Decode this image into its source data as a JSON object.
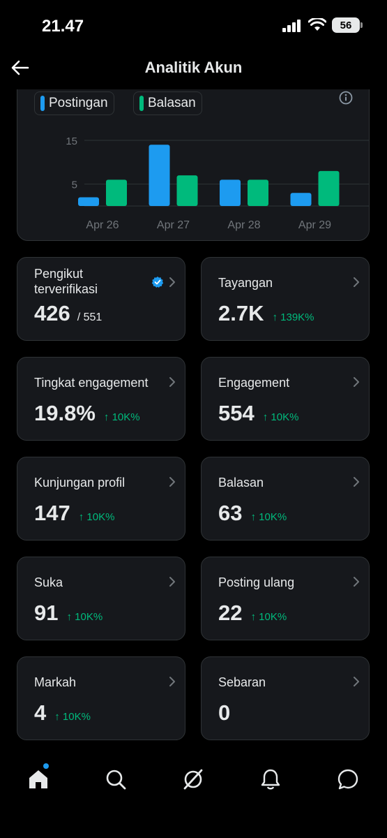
{
  "status_bar": {
    "time": "21.47",
    "battery": "56"
  },
  "header": {
    "title": "Analitik Akun"
  },
  "chart_data": {
    "type": "bar",
    "categories": [
      "Apr 26",
      "Apr 27",
      "Apr 28",
      "Apr 29"
    ],
    "series": [
      {
        "name": "Postingan",
        "values": [
          2,
          14,
          6,
          3
        ],
        "color": "#1d9bf0"
      },
      {
        "name": "Balasan",
        "values": [
          6,
          7,
          6,
          8
        ],
        "color": "#00ba7c"
      }
    ],
    "yticks": [
      "15",
      "5"
    ],
    "ylim": [
      0,
      15
    ],
    "legend_placement": "top-left",
    "grid": true
  },
  "metrics": [
    {
      "label": "Pengikut terverifikasi",
      "value": "426",
      "total": "/ 551",
      "change": "",
      "verified": true
    },
    {
      "label": "Tayangan",
      "value": "2.7K",
      "change": "↑ 139K%"
    },
    {
      "label": "Tingkat engagement",
      "value": "19.8%",
      "change": "↑ 10K%"
    },
    {
      "label": "Engagement",
      "value": "554",
      "change": "↑ 10K%"
    },
    {
      "label": "Kunjungan profil",
      "value": "147",
      "change": "↑ 10K%"
    },
    {
      "label": "Balasan",
      "value": "63",
      "change": "↑ 10K%"
    },
    {
      "label": "Suka",
      "value": "91",
      "change": "↑ 10K%"
    },
    {
      "label": "Posting ulang",
      "value": "22",
      "change": "↑ 10K%"
    },
    {
      "label": "Markah",
      "value": "4",
      "change": "↑ 10K%"
    },
    {
      "label": "Sebaran",
      "value": "0",
      "change": ""
    }
  ],
  "bottom_nav": {
    "items": [
      "home-icon",
      "search-icon",
      "grok-icon",
      "notifications-icon",
      "messages-icon"
    ],
    "active": "home-icon"
  },
  "colors": {
    "accent": "#1d9bf0",
    "positive": "#00ba7c",
    "card": "#16181c",
    "border": "#2f3336"
  }
}
